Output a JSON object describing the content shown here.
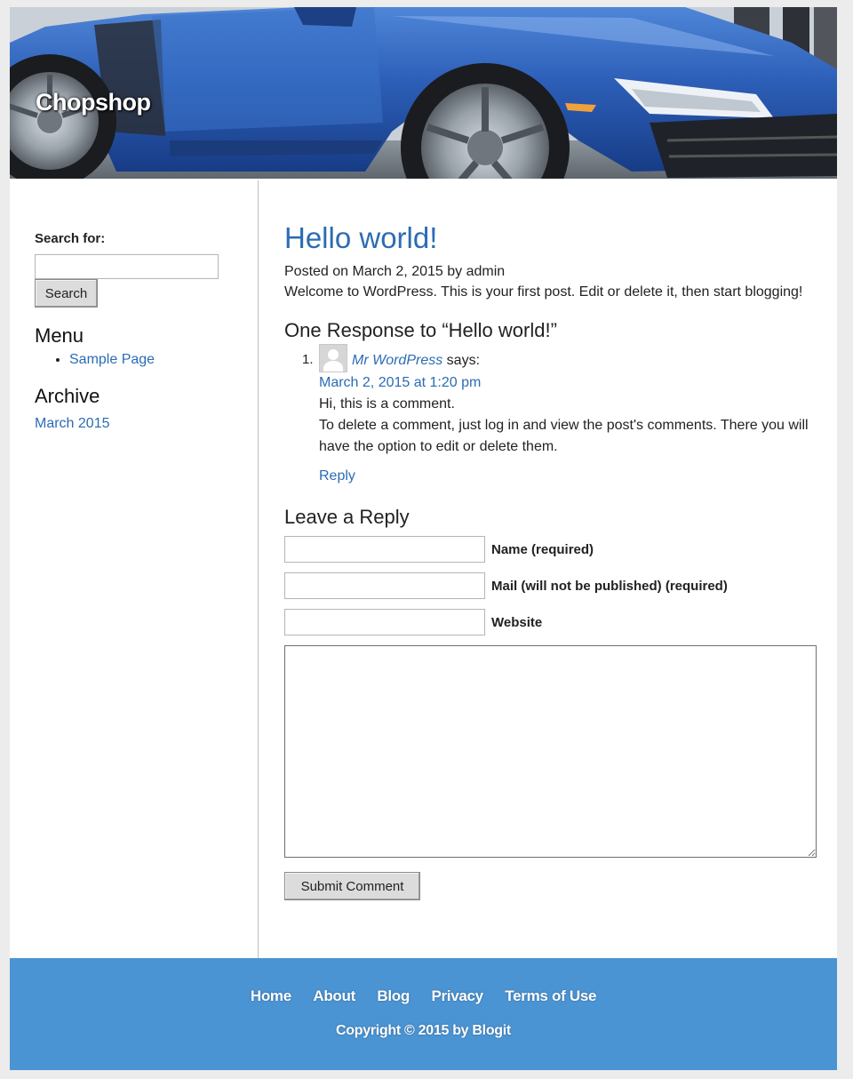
{
  "site": {
    "title": "Chopshop"
  },
  "sidebar": {
    "search_label": "Search for:",
    "search_value": "",
    "search_button": "Search",
    "menu_title": "Menu",
    "menu_items": [
      {
        "label": "Sample Page"
      }
    ],
    "archive_title": "Archive",
    "archive_items": [
      {
        "label": "March 2015"
      }
    ]
  },
  "post": {
    "title": "Hello world!",
    "meta_prefix": "Posted on ",
    "date": "March 2, 2015",
    "meta_by": " by ",
    "author": "admin",
    "body": "Welcome to WordPress. This is your first post. Edit or delete it, then start blogging!"
  },
  "comments": {
    "title": "One Response to “Hello world!”",
    "items": [
      {
        "number": "1.",
        "author": "Mr WordPress",
        "says": " says:",
        "date": "March 2, 2015 at 1:20 pm",
        "line1": "Hi, this is a comment.",
        "line2": "To delete a comment, just log in and view the post's comments. There you will have the option to edit or delete them.",
        "reply": "Reply"
      }
    ]
  },
  "reply_form": {
    "title": "Leave a Reply",
    "name_label": "Name (required)",
    "mail_label": "Mail (will not be published) (required)",
    "website_label": "Website",
    "submit_label": "Submit Comment"
  },
  "footer": {
    "nav": [
      "Home",
      "About",
      "Blog",
      "Privacy",
      "Terms of Use"
    ],
    "copyright": "Copyright © 2015 by Blogit"
  },
  "colors": {
    "link": "#2b6cb4",
    "footer_bg": "#4b94d4",
    "car_body": "#2d5fb8"
  }
}
